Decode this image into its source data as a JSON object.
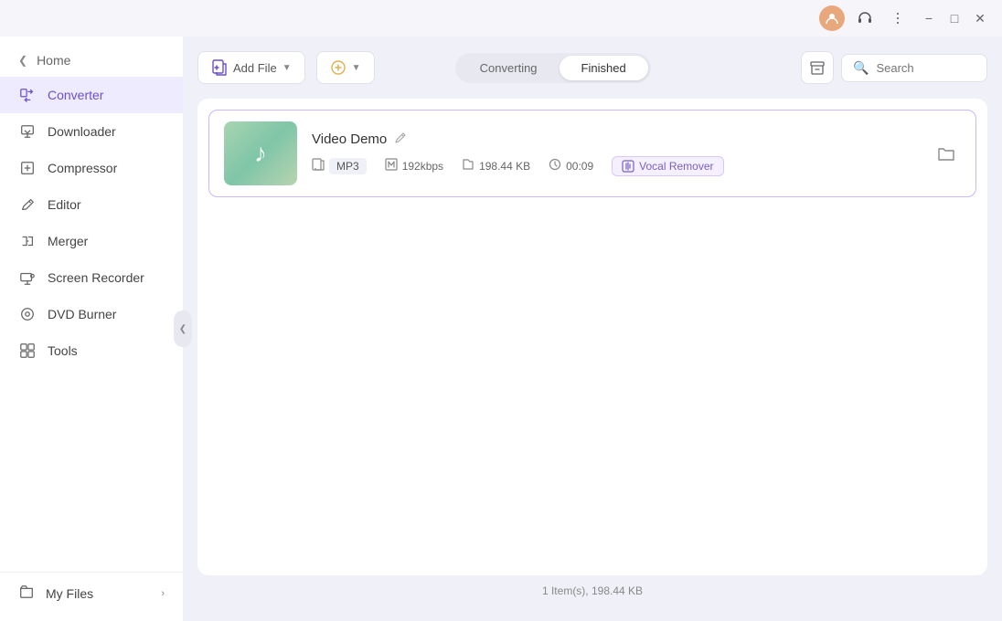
{
  "titlebar": {
    "minimize_label": "−",
    "maximize_label": "□",
    "close_label": "✕"
  },
  "sidebar": {
    "collapse_icon": "❮",
    "home_label": "Home",
    "items": [
      {
        "id": "converter",
        "label": "Converter",
        "active": true
      },
      {
        "id": "downloader",
        "label": "Downloader",
        "active": false
      },
      {
        "id": "compressor",
        "label": "Compressor",
        "active": false
      },
      {
        "id": "editor",
        "label": "Editor",
        "active": false
      },
      {
        "id": "merger",
        "label": "Merger",
        "active": false
      },
      {
        "id": "screen-recorder",
        "label": "Screen Recorder",
        "active": false
      },
      {
        "id": "dvd-burner",
        "label": "DVD Burner",
        "active": false
      },
      {
        "id": "tools",
        "label": "Tools",
        "active": false
      }
    ],
    "myfiles_label": "My Files",
    "myfiles_chevron": "›"
  },
  "toolbar": {
    "add_file_label": "Add File",
    "add_options_label": "",
    "converting_label": "Converting",
    "finished_label": "Finished",
    "search_placeholder": "Search"
  },
  "files": [
    {
      "name": "Video Demo",
      "format": "MP3",
      "bitrate": "192kbps",
      "size": "198.44 KB",
      "duration": "00:09",
      "effect": "Vocal Remover"
    }
  ],
  "statusbar": {
    "text": "1 Item(s), 198.44 KB"
  },
  "colors": {
    "accent": "#6a4fcf",
    "active_bg": "#eeebff",
    "card_border": "#c8b8f5"
  }
}
